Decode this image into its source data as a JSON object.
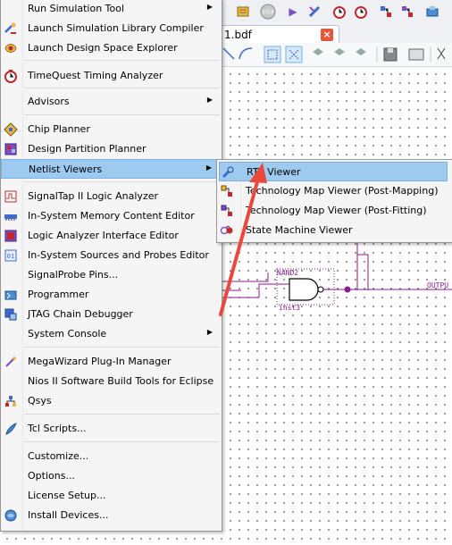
{
  "document_tab": {
    "label": "1.bdf",
    "close_label": "×"
  },
  "toolbar": {
    "icons": [
      "compile-icon",
      "stop-icon",
      "start-analysis-icon",
      "fitter-icon",
      "timing-icon",
      "timing-icon",
      "rtl-icon",
      "rtl-icon",
      "programmer-icon"
    ],
    "stop_label": "STOP"
  },
  "schematic": {
    "gate_name": "NAND2",
    "instance": "inst3",
    "output_label": "OUTPU"
  },
  "menu": {
    "items": [
      {
        "label": "Run Simulation Tool",
        "icon": "simulation-icon",
        "submenu": true
      },
      {
        "label": "Launch Simulation Library Compiler",
        "icon": "library-compiler-icon"
      },
      {
        "label": "Launch Design Space Explorer",
        "icon": "design-space-explorer-icon"
      },
      {
        "label": "TimeQuest Timing Analyzer",
        "icon": "timequest-clock-icon"
      },
      {
        "label": "Advisors",
        "icon": "",
        "submenu": true
      },
      {
        "label": "Chip Planner",
        "icon": "chip-planner-icon"
      },
      {
        "label": "Design Partition Planner",
        "icon": "partition-planner-icon"
      },
      {
        "label": "Netlist Viewers",
        "icon": "",
        "submenu": true,
        "selected": true
      },
      {
        "label": "SignalTap II Logic Analyzer",
        "icon": "signaltap-icon"
      },
      {
        "label": "In-System Memory Content Editor",
        "icon": "memory-editor-icon"
      },
      {
        "label": "Logic Analyzer Interface Editor",
        "icon": "logic-analyzer-interface-icon"
      },
      {
        "label": "In-System Sources and Probes Editor",
        "icon": "sources-probes-icon"
      },
      {
        "label": "SignalProbe Pins...",
        "icon": ""
      },
      {
        "label": "Programmer",
        "icon": "programmer-icon"
      },
      {
        "label": "JTAG Chain Debugger",
        "icon": "jtag-debugger-icon"
      },
      {
        "label": "System Console",
        "icon": "",
        "submenu": true
      },
      {
        "label": "MegaWizard Plug-In Manager",
        "icon": "megawizard-wand-icon"
      },
      {
        "label": "Nios II Software Build Tools for Eclipse",
        "icon": ""
      },
      {
        "label": "Qsys",
        "icon": "qsys-icon"
      },
      {
        "label": "Tcl Scripts...",
        "icon": "tcl-scripts-icon"
      },
      {
        "label": "Customize...",
        "icon": ""
      },
      {
        "label": "Options...",
        "icon": ""
      },
      {
        "label": "License Setup...",
        "icon": ""
      },
      {
        "label": "Install Devices...",
        "icon": "install-devices-icon"
      }
    ]
  },
  "submenu": {
    "items": [
      {
        "label": "RTL Viewer",
        "icon": "rtl-viewer-icon",
        "selected": true
      },
      {
        "label": "Technology Map Viewer (Post-Mapping)",
        "icon": "tech-map-mapping-icon"
      },
      {
        "label": "Technology Map Viewer (Post-Fitting)",
        "icon": "tech-map-fitting-icon"
      },
      {
        "label": "State Machine Viewer",
        "icon": "state-machine-icon"
      }
    ]
  },
  "colors": {
    "menu_bg": "#f5f5f5",
    "highlight": "#9fcaf0",
    "annotation_arrow": "#e8493c",
    "schematic_wire": "#8a1d8a"
  }
}
